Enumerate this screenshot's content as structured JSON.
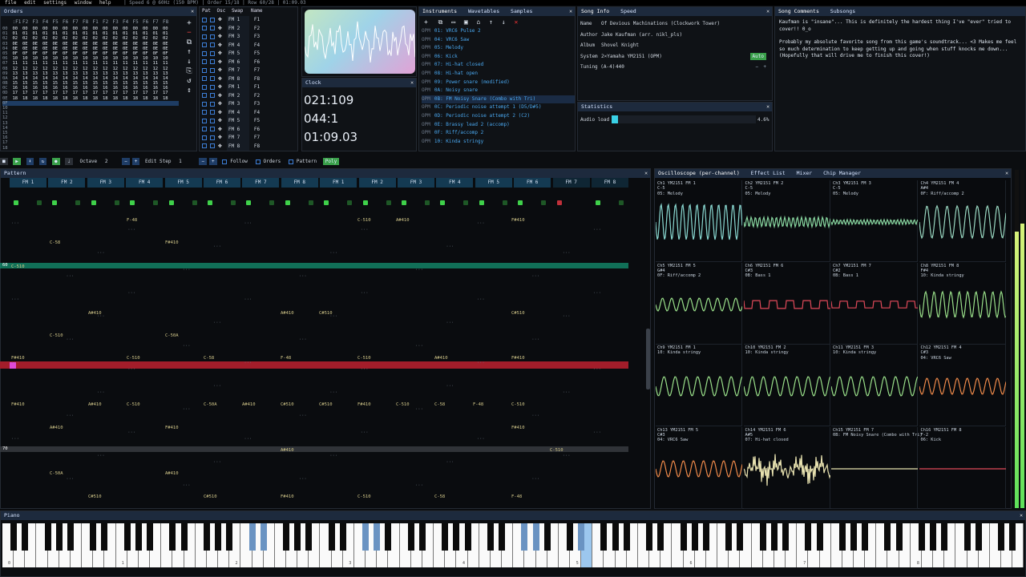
{
  "menu": {
    "items": [
      "file",
      "edit",
      "settings",
      "window",
      "help"
    ],
    "status": "| Speed 6 @ 60Hz (150 BPM) | Order 15/18 | Row 60/28 | 01:09.03"
  },
  "orders": {
    "title": "Orders",
    "header": [
      "",
      ":F1",
      "F2",
      "F3",
      "F4",
      "F5",
      "F6",
      "F7",
      "F8",
      "F1",
      "F2",
      "F3",
      "F4",
      "F5",
      "F6",
      "F7",
      "F8"
    ],
    "rows": [
      "00",
      "01",
      "02",
      "03",
      "04",
      "05",
      "06",
      "07",
      "08",
      "09",
      "0A",
      "0B",
      "0C",
      "0D",
      "0E",
      "0F",
      "10",
      "11",
      "12",
      "13",
      "14",
      "15",
      "16",
      "17",
      "18"
    ],
    "values": [
      "00",
      "00",
      "00",
      "00",
      "00",
      "00",
      "00",
      "00",
      "00",
      "00",
      "00",
      "00",
      "00",
      "00",
      "00",
      "00",
      "01",
      "01",
      "01",
      "01",
      "01",
      "01",
      "01",
      "01",
      "01",
      "01",
      "01",
      "01",
      "01",
      "01",
      "01",
      "01",
      "02",
      "02",
      "02",
      "02",
      "02",
      "02",
      "02",
      "02",
      "02",
      "02",
      "02",
      "02",
      "02",
      "02",
      "02",
      "02",
      "0E",
      "0E",
      "0E",
      "0E",
      "0E",
      "0E",
      "0E",
      "0E",
      "0E",
      "0E",
      "0E",
      "0E",
      "0E",
      "0E",
      "0E",
      "0E",
      "0E",
      "0E",
      "0E",
      "0E",
      "0E",
      "0E",
      "0E",
      "0E",
      "0E",
      "0E",
      "0E",
      "0E",
      "0E",
      "0E",
      "0E",
      "0E",
      "0F",
      "0F",
      "0F",
      "0F",
      "0F",
      "0F",
      "0F",
      "0F",
      "0F",
      "0F",
      "0F",
      "0F",
      "0F",
      "0F",
      "0F",
      "0F",
      "10",
      "10",
      "10",
      "10",
      "10",
      "10",
      "10",
      "10",
      "10",
      "10",
      "10",
      "10",
      "10",
      "10",
      "10",
      "10",
      "11",
      "11",
      "11",
      "11",
      "11",
      "11",
      "11",
      "11",
      "11",
      "11",
      "11",
      "11",
      "11",
      "11",
      "11",
      "11",
      "12",
      "12",
      "12",
      "12",
      "12",
      "12",
      "12",
      "12",
      "12",
      "12",
      "12",
      "12",
      "12",
      "12",
      "12",
      "12",
      "13",
      "13",
      "13",
      "13",
      "13",
      "13",
      "13",
      "13",
      "13",
      "13",
      "13",
      "13",
      "13",
      "13",
      "13",
      "13",
      "14",
      "14",
      "14",
      "14",
      "14",
      "14",
      "14",
      "14",
      "14",
      "14",
      "14",
      "14",
      "14",
      "14",
      "14",
      "14",
      "15",
      "15",
      "15",
      "15",
      "15",
      "15",
      "15",
      "15",
      "15",
      "15",
      "15",
      "15",
      "15",
      "15",
      "15",
      "15",
      "16",
      "16",
      "16",
      "16",
      "16",
      "16",
      "16",
      "16",
      "16",
      "16",
      "16",
      "16",
      "16",
      "16",
      "16",
      "16",
      "17",
      "17",
      "17",
      "17",
      "17",
      "17",
      "17",
      "17",
      "17",
      "17",
      "17",
      "17",
      "17",
      "17",
      "17",
      "17",
      "18",
      "18",
      "18",
      "18",
      "18",
      "18",
      "18",
      "18",
      "18",
      "18",
      "18",
      "18",
      "18",
      "18",
      "18",
      "18"
    ]
  },
  "channels": {
    "tabs": [
      "Pat",
      "Osc",
      "Swap",
      "Name"
    ],
    "names": [
      "FM 1",
      "FM 2",
      "FM 3",
      "FM 4",
      "FM 5",
      "FM 6",
      "FM 7",
      "FM 8",
      "FM 1",
      "FM 2",
      "FM 3",
      "FM 4",
      "FM 5",
      "FM 6",
      "FM 7",
      "FM 8"
    ],
    "short": [
      "F1",
      "F2",
      "F3",
      "F4",
      "F5",
      "F6",
      "F7",
      "F8",
      "F1",
      "F2",
      "F3",
      "F4",
      "F5",
      "F6",
      "F7",
      "F8"
    ]
  },
  "clock": {
    "title": "Clock",
    "line1": "021:109",
    "line2": "044:1",
    "line3": "01:09.03"
  },
  "instruments": {
    "tabs": [
      "Instruments",
      "Wavetables",
      "Samples"
    ],
    "list": [
      {
        "tag": "OPM",
        "name": "01: VRC6 Pulse 2"
      },
      {
        "tag": "OPM",
        "name": "04: VRC6 Saw"
      },
      {
        "tag": "OPM",
        "name": "05: Melody"
      },
      {
        "tag": "OPM",
        "name": "06: Kick"
      },
      {
        "tag": "OPM",
        "name": "07: Hi-hat closed"
      },
      {
        "tag": "OPM",
        "name": "08: Hi-hat open"
      },
      {
        "tag": "OPM",
        "name": "09: Power snare (modified)"
      },
      {
        "tag": "OPM",
        "name": "0A: Noisy snare"
      },
      {
        "tag": "OPM",
        "name": "0B: FM Noisy Snare (Combo with Tri)"
      },
      {
        "tag": "OPM",
        "name": "0C: Periodic noise attempt 1 (D5/D#5)"
      },
      {
        "tag": "OPM",
        "name": "0D: Periodic noise attempt 2 (C2)"
      },
      {
        "tag": "OPM",
        "name": "0E: Brassy lead 2 (accomp)"
      },
      {
        "tag": "OPM",
        "name": "0F: Riff/accomp 2"
      },
      {
        "tag": "OPM",
        "name": "10: Kinda stringy"
      }
    ]
  },
  "songinfo": {
    "tabs": [
      "Song Info",
      "Speed"
    ],
    "name_label": "Name",
    "name": "Of Devious Machinations (Clockwork Tower)",
    "author_label": "Author",
    "author": "Jake Kaufman (arr. nikl_pls)",
    "album_label": "Album",
    "album": "Shovel Knight",
    "system_label": "System",
    "system": "2×Yamaha YM2151 (OPM)",
    "auto": "Auto",
    "tuning_label": "Tuning (A-4)",
    "tuning": "440"
  },
  "stats": {
    "title": "Statistics",
    "audio_label": "Audio load",
    "audio_value": "4.6%",
    "audio_fraction": 0.046
  },
  "comments": {
    "tabs": [
      "Song Comments",
      "Subsongs"
    ],
    "text1": "Kaufman is \"insane\"... This is definitely the hardest thing I've \"ever\" tried to cover!! 0_o",
    "text2": "Probably my absolute favorite song from this game's soundtrack... <3 Makes me feel so much determination to keep getting up and going when stuff knocks me down... (Hopefully that will drive me to finish this cover!)"
  },
  "toolbar": {
    "octave_label": "Octave",
    "octave": "2",
    "editstep_label": "Edit Step",
    "editstep": "1",
    "follow": "Follow",
    "orders": "Orders",
    "pattern": "Pattern",
    "poly": "Poly"
  },
  "pattern": {
    "title": "Pattern",
    "heads": [
      "FM 1",
      "FM 2",
      "FM 3",
      "FM 4",
      "FM 5",
      "FM 6",
      "FM 7",
      "FM 8",
      "FM 1",
      "FM 2",
      "FM 3",
      "FM 4",
      "FM 5",
      "FM 6",
      "FM 7",
      "FM 8"
    ],
    "rowA": "60",
    "rowB": "70",
    "notes": [
      [
        "C-5",
        "10",
        "0",
        "F"
      ],
      [
        "C-5",
        "8",
        "60",
        "F"
      ],
      [
        "F-4",
        "8",
        "60",
        "C"
      ],
      [
        "C-5",
        "10",
        "0",
        "C"
      ],
      [
        "A#4",
        "10",
        "2",
        "H"
      ],
      [
        "F#4",
        "10",
        "2",
        "H"
      ],
      [
        "F#4",
        "10",
        "2",
        "L"
      ],
      [
        "A#4",
        "10",
        "2",
        "L"
      ],
      [
        "C-5",
        "10",
        "2",
        "L"
      ],
      [
        "C-5",
        "0A",
        "4",
        "F"
      ],
      [
        "A#4",
        "10",
        "4",
        "F"
      ],
      [
        "C#5",
        "10",
        "4",
        "F"
      ],
      [
        "C#5",
        "10",
        "4",
        "L"
      ],
      [
        "F#4",
        "10",
        "4",
        "L"
      ]
    ]
  },
  "osc": {
    "tabs": [
      "Oscilloscope (per-channel)",
      "Effect List",
      "Mixer",
      "Chip Manager"
    ],
    "cells": [
      {
        "l1": "Ch1 YM2151 FM 1",
        "l2": "C-5",
        "l3": "05: Melody",
        "color": "#8ad9d2"
      },
      {
        "l1": "Ch2 YM2151 FM 2",
        "l2": "C-5",
        "l3": "05: Melody",
        "color": "#8ad9a2"
      },
      {
        "l1": "Ch3 YM2151 FM 3",
        "l2": "C-5",
        "l3": "05: Melody",
        "color": "#8ad9a2"
      },
      {
        "l1": "Ch4 YM2151 FM 4",
        "l2": "A#4",
        "l3": "0F: Riff/accomp 2",
        "color": "#9ad9c2"
      },
      {
        "l1": "Ch5 YM2151 FM 5",
        "l2": "G#4",
        "l3": "0F: Riff/accomp 2",
        "color": "#9ae08a"
      },
      {
        "l1": "Ch6 YM2151 FM 6",
        "l2": "C#3",
        "l3": "0B: Bass 1",
        "color": "#e24a5a"
      },
      {
        "l1": "Ch7 YM2151 FM 7",
        "l2": "C#2",
        "l3": "0B: Bass 1",
        "color": "#e24a5a"
      },
      {
        "l1": "Ch8 YM2151 FM 8",
        "l2": "F#4",
        "l3": "10: Kinda stringy",
        "color": "#9ae08a"
      },
      {
        "l1": "Ch9 YM2151 FM 1",
        "l2": "",
        "l3": "10: Kinda stringy",
        "color": "#9ae08a"
      },
      {
        "l1": "Ch10 YM2151 FM 2",
        "l2": "",
        "l3": "10: Kinda stringy",
        "color": "#9ae08a"
      },
      {
        "l1": "Ch11 YM2151 FM 3",
        "l2": "",
        "l3": "10: Kinda stringy",
        "color": "#9ae08a"
      },
      {
        "l1": "Ch12 YM2151 FM 4",
        "l2": "C#3",
        "l3": "04: VRC6 Saw",
        "color": "#ef8a4a"
      },
      {
        "l1": "Ch13 YM2151 FM 5",
        "l2": "C#3",
        "l3": "04: VRC6 Saw",
        "color": "#ef8a4a"
      },
      {
        "l1": "Ch14 YM2151 FM 6",
        "l2": "A#5",
        "l3": "07: Hi-hat closed",
        "color": "#e8e2b0"
      },
      {
        "l1": "Ch15 YM2151 FM 7",
        "l2": "",
        "l3": "0B: FM Noisy Snare (Combo with Tri)",
        "color": "#e8e2b0"
      },
      {
        "l1": "Ch16 YM2151 FM 8",
        "l2": "F-2",
        "l3": "06: Kick",
        "color": "#e24a5a"
      }
    ]
  },
  "piano": {
    "title": "Piano",
    "octaves": [
      "0",
      "1",
      "2",
      "3",
      "4",
      "5",
      "6",
      "7",
      "8"
    ]
  },
  "colors": {
    "accent": "#3d7fd8",
    "play": "#3fd14a",
    "cursor": "#b01c2a",
    "highlight": "#1aa07a"
  }
}
